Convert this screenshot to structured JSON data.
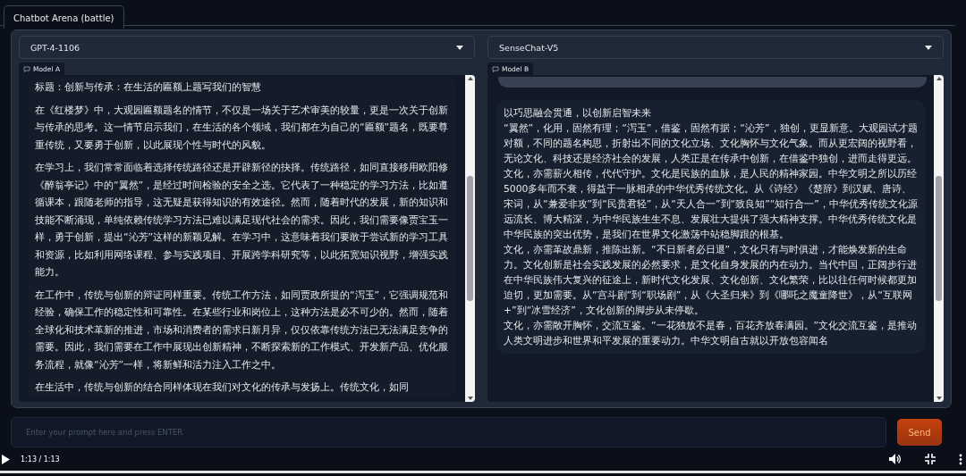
{
  "tab": {
    "label": "Chatbot Arena (battle)",
    "selected": true
  },
  "models": [
    {
      "dropdown": "GPT-4-1106",
      "label": "Model A",
      "previous_message_visible": false,
      "message": {
        "kind": "spaced",
        "paragraphs": [
          "标题：创新与传承：在生活的匾额上题写我们的智慧",
          "在《红楼梦》中，大观园匾额题名的情节，不仅是一场关于艺术审美的较量，更是一次关于创新与传承的思考。这一情节启示我们，在生活的各个领域，我们都在为自己的“匾额”题名，既要尊重传统，又要勇于创新，以此展现个性与时代的风貌。",
          "在学习上，我们常常面临着选择传统路径还是开辟新径的抉择。传统路径，如同直接移用欧阳修《醉翁亭记》中的“翼然”，是经过时间检验的安全之选。它代表了一种稳定的学习方法，比如遵循课本，跟随老师的指导，这无疑是获得知识的有效途径。然而，随着时代的发展，新的知识和技能不断涌现，单纯依赖传统学习方法已难以满足现代社会的需求。因此，我们需要像贾宝玉一样，勇于创新，提出“沁芳”这样的新颖见解。在学习中，这意味着我们要敢于尝试新的学习工具和资源，比如利用网络课程、参与实践项目、开展跨学科研究等，以此拓宽知识视野，增强实践能力。",
          "在工作中，传统与创新的辩证同样重要。传统工作方法，如同贾政所提的“泻玉”，它强调规范和经验，确保工作的稳定性和可靠性。在某些行业和岗位上，这种方法是必不可少的。然而，随着全球化和技术革新的推进，市场和消费者的需求日新月异，仅仅依靠传统方法已无法满足竞争的需要。因此，我们需要在工作中展现出创新精神，不断探索新的工作模式、开发新产品、优化服务流程，就像“沁芳”一样，将新鲜和活力注入工作之中。",
          "在生活中，传统与创新的结合同样体现在我们对文化的传承与发扬上。传统文化，如同"
        ]
      }
    },
    {
      "dropdown": "SenseChat-V5",
      "label": "Model B",
      "previous_message_visible": true,
      "message": {
        "kind": "plain",
        "paragraphs": [
          "以巧思融会贯通，以创新启智未来",
          "“翼然”，化用，固然有理；“泻玉”，借鉴，固然有据；“沁芳”，独创，更显新意。大观园试才题对额，不同的题名构思，折射出不同的文化立场、文化胸怀与文化气象。而从更宏阔的视野看，无论文化、科技还是经济社会的发展，人类正是在传承中创新，在借鉴中独创，进而走得更远。",
          "文化，亦需薪火相传，代代守护。文化是民族的血脉，是人民的精神家园。中华文明之所以历经5000多年而不衰，得益于一脉相承的中华优秀传统文化。从《诗经》《楚辞》到汉赋、唐诗、宋词，从“兼爱非攻”到“民贵君轻”，从“天人合一”到“致良知”“知行合一”，中华优秀传统文化源远流长、博大精深，为中华民族生生不息、发展壮大提供了强大精神支撑。中华优秀传统文化是中华民族的突出优势，是我们在世界文化激荡中站稳脚跟的根基。",
          "文化，亦需革故鼎新，推陈出新。“不日新者必日退”，文化只有与时俱进，才能焕发新的生命力。文化创新是社会实践发展的必然要求，是文化自身发展的内在动力。当代中国，正阔步行进在中华民族伟大复兴的征途上，新时代文化发展、文化创新、文化繁荣，比以往任何时候都更加迫切，更加需要。从“宫斗剧”到“职场剧”，从《大圣归来》到《哪吒之魔童降世》，从“互联网+”到“冰雪经济”，文化创新的脚步从未停歇。",
          "文化，亦需敞开胸怀，交流互鉴。“一花独放不是春，百花齐放春满园。”文化交流互鉴，是推动人类文明进步和世界和平发展的重要动力。中华文明自古就以开放包容闻名"
        ]
      }
    }
  ],
  "input": {
    "placeholder": "Enter your prompt here and press ENTER"
  },
  "send_button": "Send",
  "video": {
    "time": "1:13 / 1:13",
    "progress": {
      "level": 1
    }
  }
}
